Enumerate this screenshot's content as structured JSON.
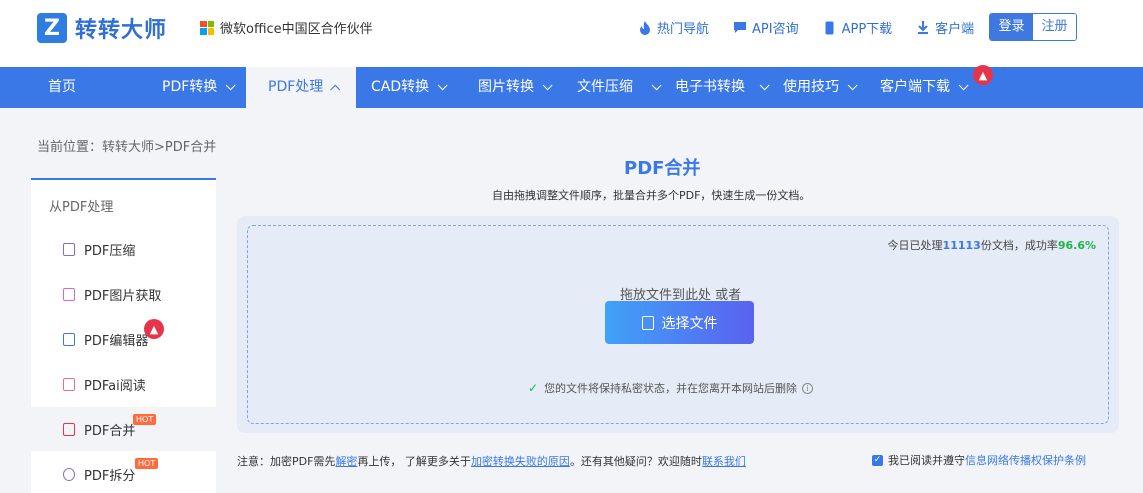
{
  "header": {
    "logo_mark": "Z",
    "logo_text": "转转大师",
    "partner": "微软office中国区合作伙伴",
    "links": [
      {
        "label": "热门导航",
        "icon": "flame-icon"
      },
      {
        "label": "API咨询",
        "icon": "chat-icon"
      },
      {
        "label": "APP下载",
        "icon": "phone-icon"
      },
      {
        "label": "客户端",
        "icon": "download-icon"
      }
    ],
    "login": "登录",
    "register": "注册"
  },
  "nav": {
    "items": [
      {
        "label": "首页"
      },
      {
        "label": "PDF转换"
      },
      {
        "label": "PDF处理"
      },
      {
        "label": "CAD转换"
      },
      {
        "label": "图片转换"
      },
      {
        "label": "文件压缩"
      },
      {
        "label": "电子书转换"
      },
      {
        "label": "使用技巧"
      },
      {
        "label": "客户端下载"
      }
    ]
  },
  "breadcrumb": "当前位置：转转大师>PDF合并",
  "sidebar": {
    "heading": "从PDF处理",
    "items": [
      {
        "label": "PDF压缩"
      },
      {
        "label": "PDF图片获取"
      },
      {
        "label": "PDF编辑器"
      },
      {
        "label": "PDFai阅读"
      },
      {
        "label": "PDF合并",
        "badge": "HOT"
      },
      {
        "label": "PDF拆分",
        "badge": "HOT"
      }
    ]
  },
  "main": {
    "title": "PDF合并",
    "subtitle": "自由拖拽调整文件顺序，批量合并多个PDF，快速生成一份文档。",
    "stat_prefix": "今日已处理",
    "stat_count": "11113",
    "stat_mid": "份文档，成功率",
    "stat_rate": "96.6%",
    "drop_hint": "拖放文件到此处 或者",
    "choose_button": "选择文件",
    "privacy": "您的文件将保持私密状态，并在您离开本网站后删除"
  },
  "footer": {
    "note_prefix": "注意：加密PDF需先",
    "note_link1": "解密",
    "note_mid": "再上传， 了解更多关于",
    "note_link2": "加密转换失败的原因",
    "note_mid2": "。还有其他疑问？欢迎随时",
    "note_link3": "联系我们",
    "agree_prefix": "我已阅读并遵守",
    "agree_link": "信息网络传播权保护条例"
  },
  "colors": {
    "accent": "#3b78e7",
    "success": "#1fb44a",
    "hot": "#ff6b3d",
    "fire": "#e8344b"
  }
}
